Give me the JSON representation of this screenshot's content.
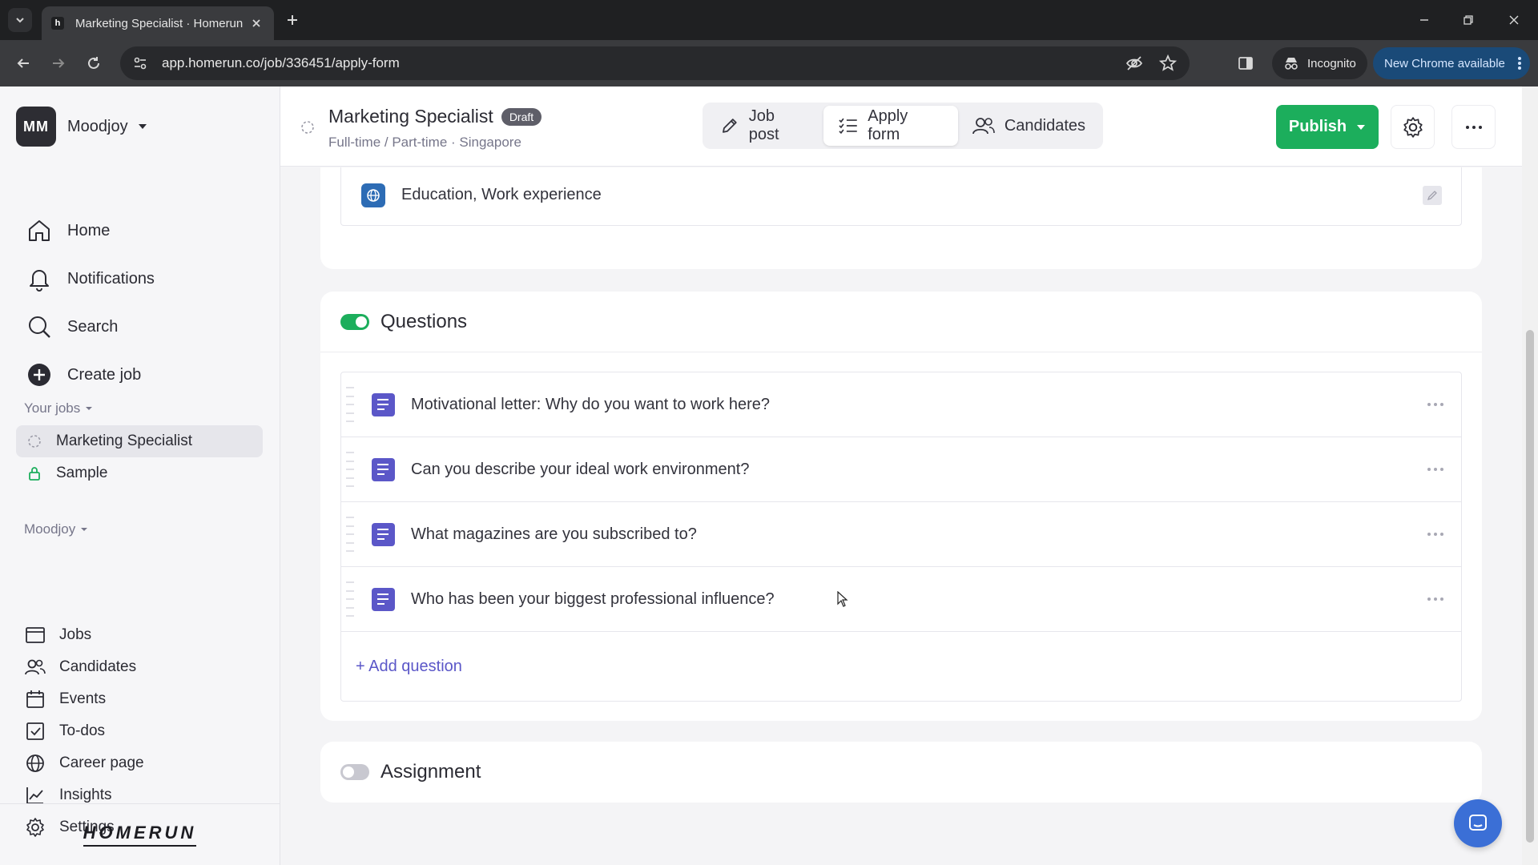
{
  "browser": {
    "tab_title": "Marketing Specialist · Homerun",
    "favicon_letter": "h",
    "url": "app.homerun.co/job/336451/apply-form",
    "incognito_label": "Incognito",
    "update_label": "New Chrome available"
  },
  "sidebar": {
    "workspace": {
      "initials": "MM",
      "name": "Moodjoy"
    },
    "main_nav": [
      {
        "label": "Home",
        "icon": "home-icon"
      },
      {
        "label": "Notifications",
        "icon": "bell-icon"
      },
      {
        "label": "Search",
        "icon": "search-icon"
      },
      {
        "label": "Create job",
        "icon": "plus-circle-icon"
      }
    ],
    "jobs_section_label": "Your jobs",
    "jobs": [
      {
        "label": "Marketing Specialist",
        "icon": "draft-status-icon",
        "active": true
      },
      {
        "label": "Sample",
        "icon": "lock-icon",
        "active": false
      }
    ],
    "org_section_label": "Moodjoy",
    "org_nav": [
      {
        "label": "Jobs",
        "icon": "jobs-icon"
      },
      {
        "label": "Candidates",
        "icon": "candidates-icon"
      },
      {
        "label": "Events",
        "icon": "calendar-icon"
      },
      {
        "label": "To-dos",
        "icon": "checkbox-icon"
      },
      {
        "label": "Career page",
        "icon": "globe-icon"
      },
      {
        "label": "Insights",
        "icon": "chart-icon"
      },
      {
        "label": "Settings",
        "icon": "gear-icon"
      }
    ],
    "logo_text": "HOMERUN"
  },
  "header": {
    "job_title": "Marketing Specialist",
    "status_badge": "Draft",
    "subtitle": "Full-time / Part-time · Singapore",
    "tabs": [
      {
        "label": "Job post",
        "icon": "pencil-icon",
        "active": false
      },
      {
        "label": "Apply form",
        "icon": "checklist-icon",
        "active": true
      },
      {
        "label": "Candidates",
        "icon": "candidates-icon",
        "active": false
      }
    ],
    "publish_label": "Publish"
  },
  "profile_section": {
    "row_text": "Education, Work experience"
  },
  "questions_section": {
    "title": "Questions",
    "enabled": true,
    "items": [
      {
        "text": "Motivational letter: Why do you want to work here?"
      },
      {
        "text": "Can you describe your ideal work environment?"
      },
      {
        "text": "What magazines are you subscribed to?"
      },
      {
        "text": "Who has been your biggest professional influence?"
      }
    ],
    "add_label": "+ Add question"
  },
  "assignment_section": {
    "title": "Assignment",
    "enabled": false
  },
  "colors": {
    "brand_green": "#1cae5c",
    "question_icon": "#5b57c8",
    "chat_blue": "#3b6fd6"
  }
}
